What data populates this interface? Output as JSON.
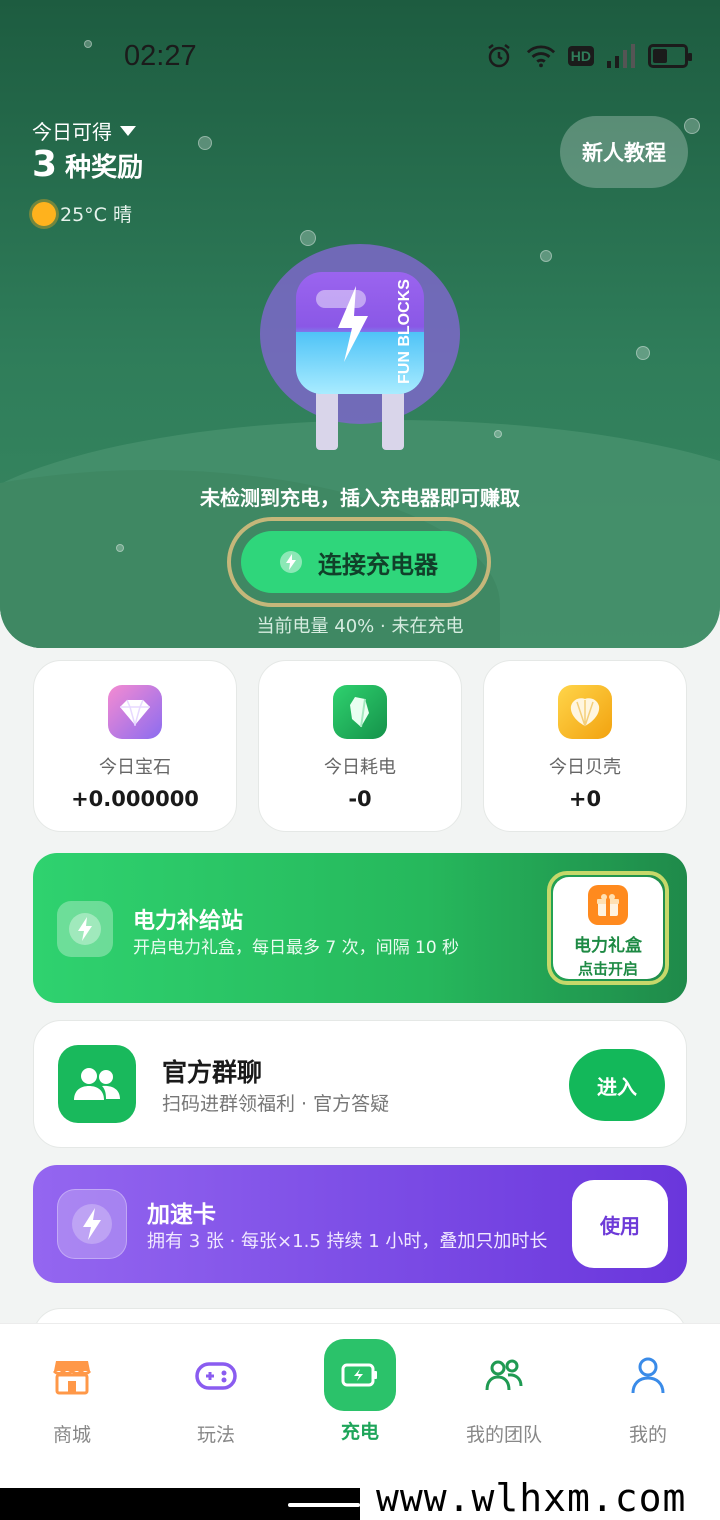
{
  "status_bar": {
    "time": "02:27",
    "network_badge": "HD"
  },
  "hero": {
    "reward_label": "今日可得",
    "reward_count": "3",
    "reward_unit": "种奖励",
    "weather": "25°C 晴",
    "tutorial_button": "新人教程",
    "charger_brand": "FUN BLOCKS",
    "charge_message": "未检测到充电，插入充电器即可赚取",
    "connect_button": "连接充电器",
    "battery_status": "当前电量 40% · 未在充电",
    "battery_level": 0.4
  },
  "stats": [
    {
      "label": "今日宝石",
      "value": "+0.000000",
      "icon": "gem-icon"
    },
    {
      "label": "今日耗电",
      "value": "-0",
      "icon": "crystal-icon"
    },
    {
      "label": "今日贝壳",
      "value": "+0",
      "icon": "shell-icon"
    }
  ],
  "power_station": {
    "title": "电力补给站",
    "subtitle": "开启电力礼盒，每日最多 7 次，间隔 10 秒",
    "gift_title": "电力礼盒",
    "gift_action": "点击开启"
  },
  "group_chat": {
    "title": "官方群聊",
    "subtitle": "扫码进群领福利 · 官方答疑",
    "button": "进入"
  },
  "boost_card": {
    "title": "加速卡",
    "subtitle": "拥有 3 张 · 每张×1.5 持续 1 小时，叠加只加时长",
    "button": "使用"
  },
  "tabs": [
    {
      "label": "商城",
      "icon": "store-icon"
    },
    {
      "label": "玩法",
      "icon": "gamepad-icon"
    },
    {
      "label": "充电",
      "icon": "battery-charge-icon",
      "active": true
    },
    {
      "label": "我的团队",
      "icon": "team-icon"
    },
    {
      "label": "我的",
      "icon": "user-icon"
    }
  ],
  "watermark": "www.wlhxm.com",
  "colors": {
    "primary_green": "#2fd67b",
    "purple": "#7d4ee6",
    "hero_green": "#2f7d5a"
  }
}
